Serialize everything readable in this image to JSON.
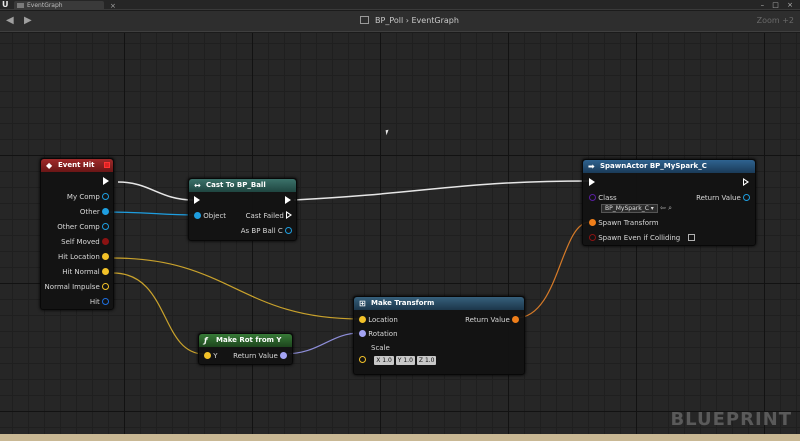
{
  "window": {
    "tab_label": "EventGraph",
    "tab_close": "×",
    "controls": "– □ ×"
  },
  "breadcrumb": {
    "blueprint": "BP_Poll",
    "separator": "›",
    "graph": "EventGraph"
  },
  "zoom": "Zoom +2",
  "watermark": "BLUEPRINT",
  "nodes": {
    "event_hit": {
      "title": "Event Hit",
      "pins": [
        "My Comp",
        "Other",
        "Other Comp",
        "Self Moved",
        "Hit Location",
        "Hit Normal",
        "Normal Impulse",
        "Hit"
      ]
    },
    "cast_to": {
      "title": "Cast To BP_Ball",
      "object_pin": "Object",
      "cast_failed_pin": "Cast Failed",
      "as_pin": "As BP Ball C"
    },
    "spawn_actor": {
      "title": "SpawnActor BP_MySpark_C",
      "class_pin": "Class",
      "class_value": "BP_MySpark_C",
      "return_pin": "Return Value",
      "spawn_transform_pin": "Spawn Transform",
      "spawn_even_pin": "Spawn Even if Colliding"
    },
    "make_rot": {
      "title": "Make Rot from Y",
      "y_pin": "Y",
      "return_pin": "Return Value"
    },
    "make_transform": {
      "title": "Make Transform",
      "location_pin": "Location",
      "rotation_pin": "Rotation",
      "scale_pin": "Scale",
      "return_pin": "Return Value",
      "scale_x": "X 1.0",
      "scale_y": "Y 1.0",
      "scale_z": "Z 1.0"
    }
  },
  "colors": {
    "event_header": "#8a1f1f",
    "cast_header": "#2f5f5a",
    "spawn_header": "#1f4a70",
    "make_rot_header": "#2a5a2a",
    "make_transform_header": "#2a4a60",
    "object_pin": "#1e9ee0",
    "vector_pin": "#f2c128",
    "rotator_pin": "#a3a3f3",
    "transform_pin": "#ef7e1a",
    "bool_pin": "#8b1212",
    "float_pin": "#a8e04a",
    "class_pin": "#5a1fa0"
  }
}
